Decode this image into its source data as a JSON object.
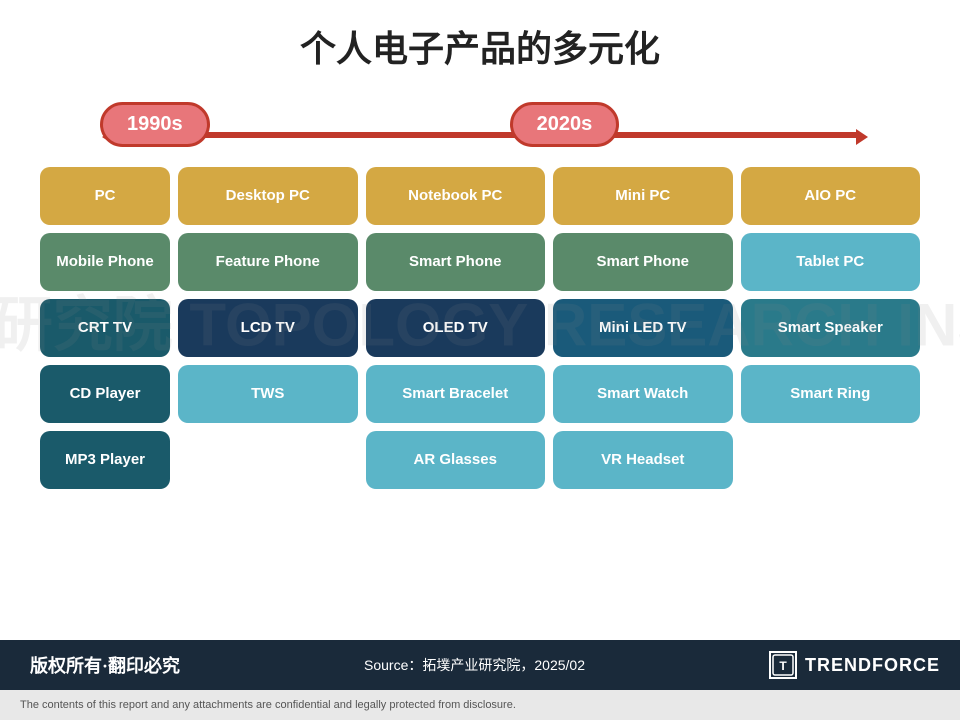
{
  "title": "个人电子产品的多元化",
  "timeline": {
    "label1990": "1990s",
    "label2020": "2020s"
  },
  "products1990": [
    {
      "label": "PC",
      "style": "gold"
    },
    {
      "label": "Mobile Phone",
      "style": "green"
    },
    {
      "label": "CRT TV",
      "style": "dark-teal"
    },
    {
      "label": "CD Player",
      "style": "dark-teal"
    },
    {
      "label": "MP3 Player",
      "style": "dark-teal"
    }
  ],
  "col1_2020": [
    {
      "label": "Desktop PC",
      "style": "gold-light"
    },
    {
      "label": "Feature Phone",
      "style": "green-light"
    },
    {
      "label": "LCD TV",
      "style": "navy"
    },
    {
      "label": "TWS",
      "style": "teal-light"
    },
    {
      "label": "",
      "style": "spacer"
    }
  ],
  "col2_2020": [
    {
      "label": "Notebook PC",
      "style": "gold-light"
    },
    {
      "label": "Smart Phone",
      "style": "green-light"
    },
    {
      "label": "OLED TV",
      "style": "navy"
    },
    {
      "label": "Smart Bracelet",
      "style": "teal-light"
    },
    {
      "label": "AR Glasses",
      "style": "teal-light"
    }
  ],
  "col3_2020": [
    {
      "label": "Mini PC",
      "style": "gold-light"
    },
    {
      "label": "Smart Phone",
      "style": "green-light"
    },
    {
      "label": "Mini LED TV",
      "style": "navy"
    },
    {
      "label": "Smart Watch",
      "style": "teal-light"
    },
    {
      "label": "VR Headset",
      "style": "teal-light"
    }
  ],
  "col4_2020": [
    {
      "label": "AIO PC",
      "style": "gold-light"
    },
    {
      "label": "Tablet PC",
      "style": "teal-light"
    },
    {
      "label": "Smart Speaker",
      "style": "med-teal"
    },
    {
      "label": "Smart Ring",
      "style": "teal-light"
    },
    {
      "label": "",
      "style": "spacer"
    }
  ],
  "watermark": "拓墣产业研究院 TOPOLOGY RESEARCH INSTITUTE",
  "footer": {
    "copyright": "版权所有·翻印必究",
    "source": "Source：拓墣产业研究院，2025/02",
    "logoText": "TRENDFORCE",
    "disclaimer": "The contents of this report and any attachments are confidential and legally protected from disclosure."
  }
}
